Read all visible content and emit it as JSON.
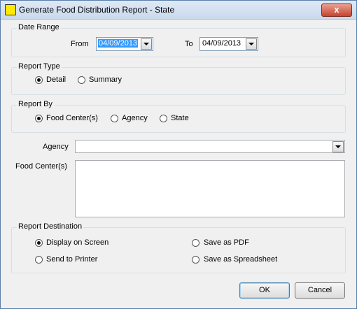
{
  "window": {
    "title": "Generate Food Distribution Report - State",
    "close_glyph": "x"
  },
  "date_range": {
    "legend": "Date Range",
    "from_label": "From",
    "from_value": "04/09/2013",
    "to_label": "To",
    "to_value": "04/09/2013"
  },
  "report_type": {
    "legend": "Report Type",
    "options": [
      "Detail",
      "Summary"
    ],
    "selected": "Detail"
  },
  "report_by": {
    "legend": "Report By",
    "options": [
      "Food Center(s)",
      "Agency",
      "State"
    ],
    "selected": "Food Center(s)"
  },
  "agency": {
    "label": "Agency",
    "value": ""
  },
  "food_centers": {
    "label": "Food Center(s)"
  },
  "report_destination": {
    "legend": "Report Destination",
    "options": [
      "Display on Screen",
      "Save as PDF",
      "Send to Printer",
      "Save as Spreadsheet"
    ],
    "selected": "Display on Screen"
  },
  "buttons": {
    "ok": "OK",
    "cancel": "Cancel"
  }
}
